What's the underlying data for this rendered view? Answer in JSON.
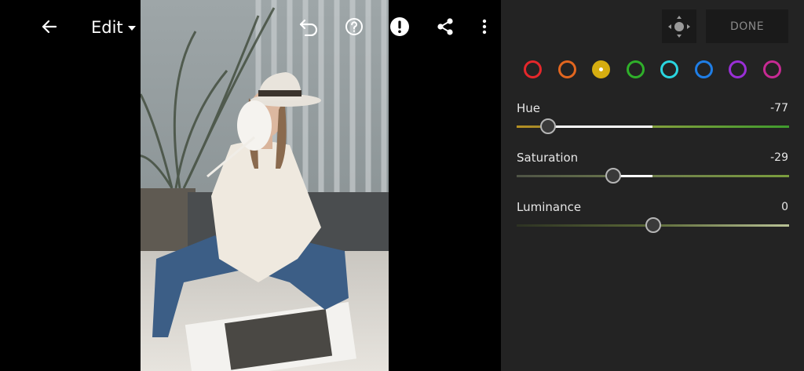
{
  "toolbar": {
    "back_icon": "arrow-left-icon",
    "edit_label": "Edit",
    "undo_icon": "undo-icon",
    "help_icon": "help-circle-icon",
    "alert_icon": "exclamation-circle-icon",
    "share_icon": "share-icon",
    "more_icon": "more-vertical-icon"
  },
  "panel": {
    "target_icon": "targeted-adjustment-icon",
    "done_label": "DONE",
    "selected_color": "yellow",
    "colors": [
      {
        "name": "red",
        "hex": "#e5272b"
      },
      {
        "name": "orange",
        "hex": "#e2661f"
      },
      {
        "name": "yellow",
        "hex": "#d6ad10"
      },
      {
        "name": "green",
        "hex": "#2fb02a"
      },
      {
        "name": "aqua",
        "hex": "#2ad6e0"
      },
      {
        "name": "blue",
        "hex": "#1f7ee6"
      },
      {
        "name": "purple",
        "hex": "#9a2fd6"
      },
      {
        "name": "magenta",
        "hex": "#c72a93"
      }
    ],
    "sliders": [
      {
        "label": "Hue",
        "value": "-77",
        "numeric": -77
      },
      {
        "label": "Saturation",
        "value": "-29",
        "numeric": -29
      },
      {
        "label": "Luminance",
        "value": "0",
        "numeric": 0
      }
    ]
  }
}
